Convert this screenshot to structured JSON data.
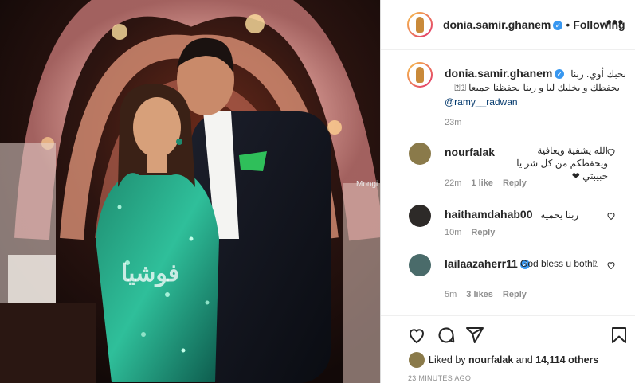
{
  "photo": {
    "watermark": "Mongi",
    "overlay_logo": "فوشيا"
  },
  "header": {
    "username": "donia.samir.ghanem",
    "verified_icon": "verified-badge-icon",
    "separator": "•",
    "following_label": "Following",
    "more_label": "•••"
  },
  "caption": {
    "username": "donia.samir.ghanem",
    "line1": "بحبك أوي. ربنا",
    "line2": "يحفظك و يخليك ليا و ربنا يحفظنا جميعا ⍰⍰",
    "mention": "@ramy__radwan",
    "time": "23m"
  },
  "comments": [
    {
      "username": "nourfalak",
      "text": "الله يشفية ويعافية ويحفظكم من كل شر يا حبيبتي ❤",
      "time": "22m",
      "likes": "1 like",
      "reply": "Reply"
    },
    {
      "username": "haithamdahab00",
      "text": "ربنا يحميه",
      "time": "10m",
      "likes": "",
      "reply": "Reply"
    },
    {
      "username": "lailaazaherr11",
      "text": "God bless u both⍰",
      "time": "5m",
      "likes": "3 likes",
      "reply": "Reply"
    }
  ],
  "likes": {
    "prefix": "Liked by",
    "user": "nourfalak",
    "and": "and",
    "count": "14,114 others"
  },
  "timestamp": "23 MINUTES AGO",
  "colors": {
    "verified": "#3897f0",
    "text": "#262626",
    "muted": "#8e8e8e",
    "link": "#00376b",
    "border": "#dbdbdb"
  },
  "icons": [
    "heart-icon",
    "comment-icon",
    "share-icon",
    "bookmark-icon",
    "more-icon",
    "small-heart-icon"
  ]
}
